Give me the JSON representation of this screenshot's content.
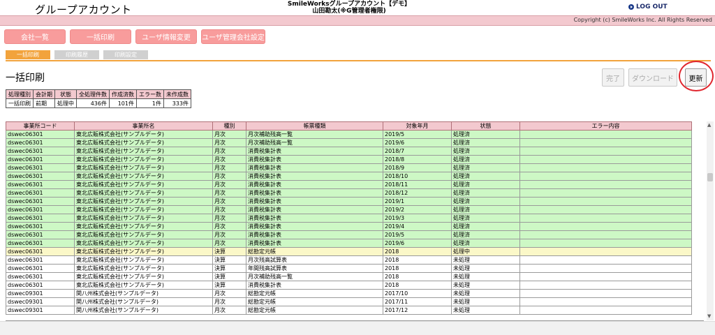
{
  "header": {
    "app_title": "グループアカウント",
    "system_line1": "SmileWorksグループアカウント【デモ】",
    "system_line2": "山田勘太(※G管理者権限)",
    "logout_label": "LOG OUT",
    "copyright": "Copyright (c) SmileWorks Inc. All Rights Reserved"
  },
  "colors": {
    "accent_nav": "#f89c9c",
    "tab_active": "#f2a33c",
    "pink_header": "#f3c9cf",
    "row_done": "#cdf8c5",
    "row_processing": "#fbf8c8",
    "highlight_circle": "#e0262e"
  },
  "main_nav": [
    "会社一覧",
    "一括印刷",
    "ユーザ情報変更",
    "ユーザ管理会社設定"
  ],
  "sub_tabs": [
    "一括印刷",
    "印刷履歴",
    "印刷設定"
  ],
  "page_title": "一括印刷",
  "actions": {
    "done": "完了",
    "download": "ダウンロード",
    "refresh": "更新"
  },
  "summary": {
    "headers": [
      "処理種別",
      "会計期",
      "状態",
      "全処理件数",
      "作成済数",
      "エラー数",
      "未作成数"
    ],
    "row": [
      "一括印刷",
      "前期",
      "処理中",
      "436件",
      "101件",
      "1件",
      "333件"
    ]
  },
  "table": {
    "headers": [
      "事業所コード",
      "事業所名",
      "種別",
      "帳票種類",
      "対象年月",
      "状態",
      "エラー内容"
    ],
    "rows": [
      [
        "dswec06301",
        "東北広販株式会社(サンプルデータ)",
        "月次",
        "月次補助残高一覧",
        "2019/5",
        "処理済",
        ""
      ],
      [
        "dswec06301",
        "東北広販株式会社(サンプルデータ)",
        "月次",
        "月次補助残高一覧",
        "2019/6",
        "処理済",
        ""
      ],
      [
        "dswec06301",
        "東北広販株式会社(サンプルデータ)",
        "月次",
        "消費税集計表",
        "2018/7",
        "処理済",
        ""
      ],
      [
        "dswec06301",
        "東北広販株式会社(サンプルデータ)",
        "月次",
        "消費税集計表",
        "2018/8",
        "処理済",
        ""
      ],
      [
        "dswec06301",
        "東北広販株式会社(サンプルデータ)",
        "月次",
        "消費税集計表",
        "2018/9",
        "処理済",
        ""
      ],
      [
        "dswec06301",
        "東北広販株式会社(サンプルデータ)",
        "月次",
        "消費税集計表",
        "2018/10",
        "処理済",
        ""
      ],
      [
        "dswec06301",
        "東北広販株式会社(サンプルデータ)",
        "月次",
        "消費税集計表",
        "2018/11",
        "処理済",
        ""
      ],
      [
        "dswec06301",
        "東北広販株式会社(サンプルデータ)",
        "月次",
        "消費税集計表",
        "2018/12",
        "処理済",
        ""
      ],
      [
        "dswec06301",
        "東北広販株式会社(サンプルデータ)",
        "月次",
        "消費税集計表",
        "2019/1",
        "処理済",
        ""
      ],
      [
        "dswec06301",
        "東北広販株式会社(サンプルデータ)",
        "月次",
        "消費税集計表",
        "2019/2",
        "処理済",
        ""
      ],
      [
        "dswec06301",
        "東北広販株式会社(サンプルデータ)",
        "月次",
        "消費税集計表",
        "2019/3",
        "処理済",
        ""
      ],
      [
        "dswec06301",
        "東北広販株式会社(サンプルデータ)",
        "月次",
        "消費税集計表",
        "2019/4",
        "処理済",
        ""
      ],
      [
        "dswec06301",
        "東北広販株式会社(サンプルデータ)",
        "月次",
        "消費税集計表",
        "2019/5",
        "処理済",
        ""
      ],
      [
        "dswec06301",
        "東北広販株式会社(サンプルデータ)",
        "月次",
        "消費税集計表",
        "2019/6",
        "処理済",
        ""
      ],
      [
        "dswec06301",
        "東北広販株式会社(サンプルデータ)",
        "決算",
        "総勘定元帳",
        "2018",
        "処理中",
        ""
      ],
      [
        "dswec06301",
        "東北広販株式会社(サンプルデータ)",
        "決算",
        "月次残高試算表",
        "2018",
        "未処理",
        ""
      ],
      [
        "dswec06301",
        "東北広販株式会社(サンプルデータ)",
        "決算",
        "年間残高試算表",
        "2018",
        "未処理",
        ""
      ],
      [
        "dswec06301",
        "東北広販株式会社(サンプルデータ)",
        "決算",
        "月次補助残高一覧",
        "2018",
        "未処理",
        ""
      ],
      [
        "dswec06301",
        "東北広販株式会社(サンプルデータ)",
        "決算",
        "消費税集計表",
        "2018",
        "未処理",
        ""
      ],
      [
        "dswec09301",
        "関八州株式会社(サンプルデータ)",
        "月次",
        "総勘定元帳",
        "2017/10",
        "未処理",
        ""
      ],
      [
        "dswec09301",
        "関八州株式会社(サンプルデータ)",
        "月次",
        "総勘定元帳",
        "2017/11",
        "未処理",
        ""
      ],
      [
        "dswec09301",
        "関八州株式会社(サンプルデータ)",
        "月次",
        "総勘定元帳",
        "2017/12",
        "未処理",
        ""
      ]
    ]
  }
}
